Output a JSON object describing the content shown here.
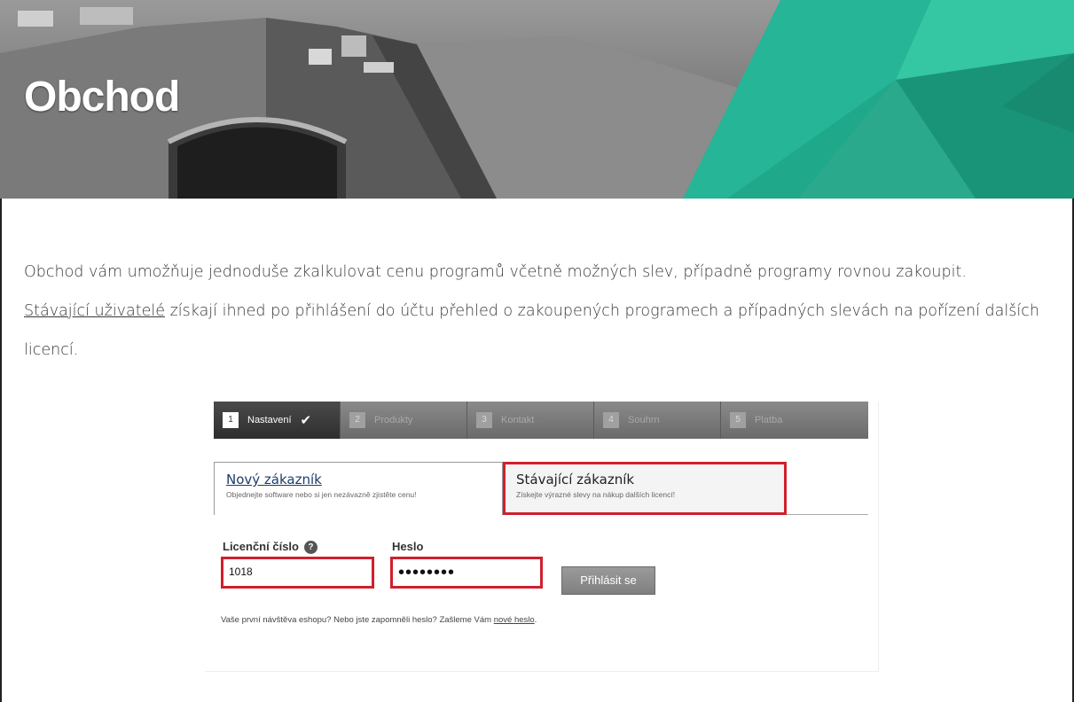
{
  "hero": {
    "title": "Obchod"
  },
  "intro": {
    "line1": "Obchod vám umožňuje jednoduše zkalkulovat cenu programů včetně možných slev, případně programy rovnou zakoupit.",
    "link": "Stávající uživatelé",
    "line2_rest": " získají ihned po přihlášení do účtu přehled o zakoupených programech a případných slevách na pořízení dalších licencí."
  },
  "steps": [
    {
      "num": "1",
      "label": "Nastavení",
      "done": true
    },
    {
      "num": "2",
      "label": "Produkty"
    },
    {
      "num": "3",
      "label": "Kontakt"
    },
    {
      "num": "4",
      "label": "Souhrn"
    },
    {
      "num": "5",
      "label": "Platba"
    }
  ],
  "tabs": {
    "new": {
      "title": "Nový zákazník",
      "subtitle": "Objednejte software nebo si jen nezávazně zjistěte cenu!"
    },
    "existing": {
      "title": "Stávající zákazník",
      "subtitle": "Získejte výrazné slevy na nákup dalších licencí!"
    }
  },
  "login": {
    "license_label": "Licenční číslo",
    "license_value": "1018",
    "password_label": "Heslo",
    "password_value": "••••••••",
    "button": "Přihlásit se",
    "note": "Vaše první návštěva eshopu? Nebo jste zapomněli heslo? Zašleme Vám ",
    "note_link": "nové heslo",
    "note_end": "."
  },
  "colors": {
    "accent_teal": "#1fa88a",
    "highlight_red": "#d0202e"
  }
}
